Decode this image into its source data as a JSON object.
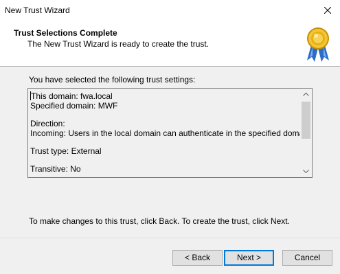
{
  "window": {
    "title": "New Trust Wizard",
    "close_icon": "close-icon"
  },
  "header": {
    "title": "Trust Selections Complete",
    "subtitle": "The New Trust Wizard is ready to create the trust.",
    "icon": "award-badge-icon"
  },
  "main": {
    "intro": "You have selected the following trust settings:",
    "settings_lines": [
      "This domain: fwa.local",
      "Specified domain: MWF",
      "",
      "Direction:",
      "Incoming: Users in the local domain can authenticate in the specified domain.",
      "",
      "Trust type: External",
      "",
      "Transitive: No"
    ],
    "footer": "To make changes to this trust, click Back. To create the trust, click Next."
  },
  "buttons": {
    "back": "< Back",
    "next": "Next >",
    "cancel": "Cancel"
  },
  "colors": {
    "default_button_border": "#0078d7",
    "badge_gold": "#e8b20c",
    "ribbon_blue": "#2b6cc4"
  }
}
